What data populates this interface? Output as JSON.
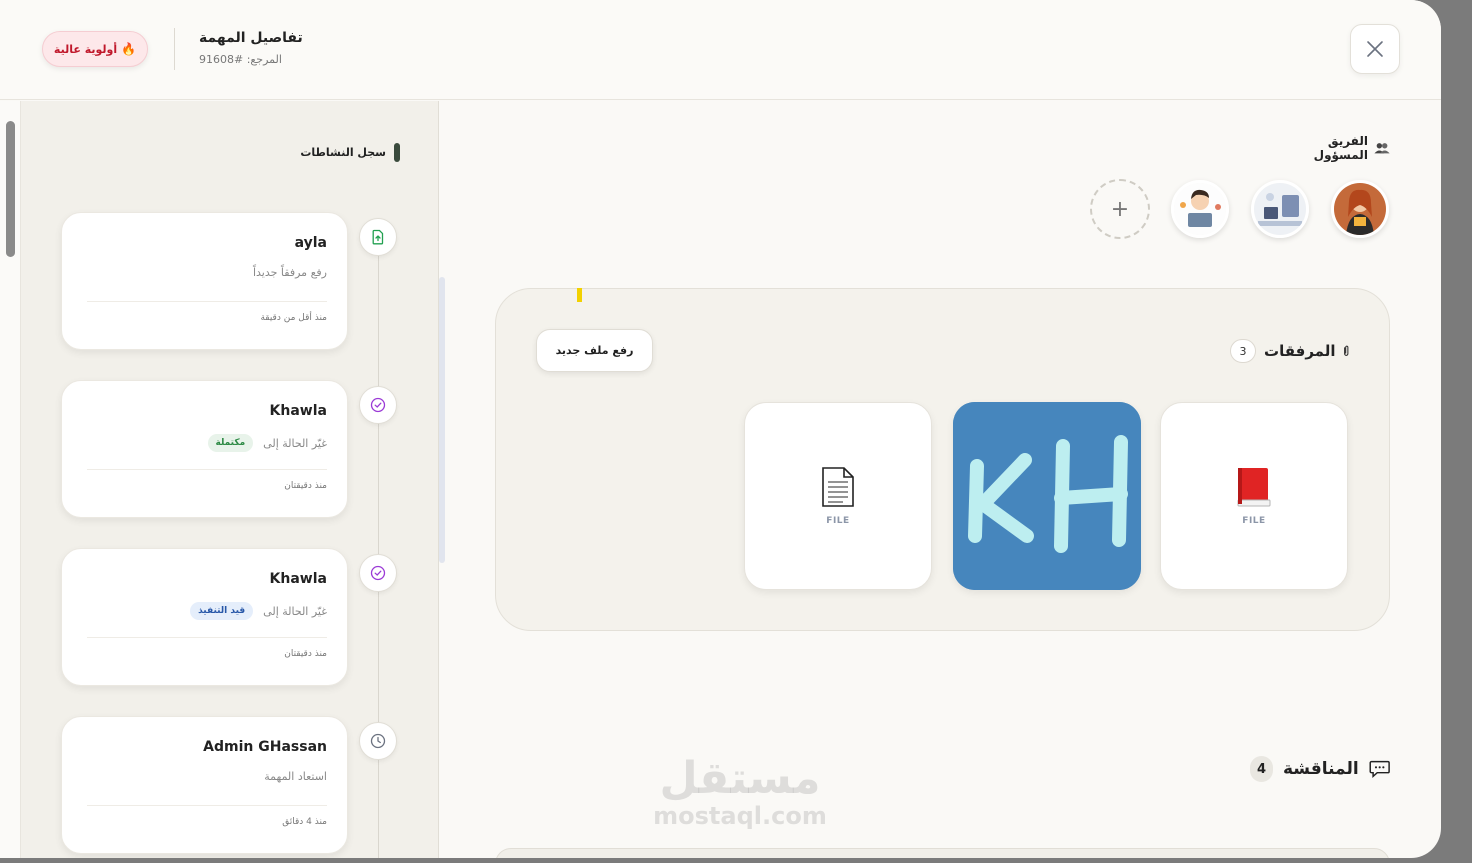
{
  "header": {
    "title": "تفاصيل المهمة",
    "reference": "المرجع: #91608",
    "priority_label": "أولوية عالية",
    "priority_icon": "fire-icon"
  },
  "activity": {
    "title": "سجل النشاطات",
    "items": [
      {
        "user": "ayla",
        "action": "رفع مرفقاً جديداً",
        "badge": "",
        "time": "منذ أقل من دقيقة",
        "icon": "file-upload-icon"
      },
      {
        "user": "Khawla",
        "action": "غيّر الحالة إلى",
        "badge": "مكتملة",
        "time": "منذ دقيقتان",
        "icon": "check-circle-icon"
      },
      {
        "user": "Khawla",
        "action": "غيّر الحالة إلى",
        "badge": "قيد التنفيذ",
        "time": "منذ دقيقتان",
        "icon": "check-circle-icon"
      },
      {
        "user": "Admin GHassan",
        "action": "استعاد المهمة",
        "badge": "",
        "time": "منذ 4 دقائق",
        "icon": "clock-icon"
      }
    ]
  },
  "team": {
    "label": "الفريق المسؤول",
    "add_label": "+"
  },
  "attachments": {
    "label": "المرفقات",
    "count": "3",
    "upload_label": "رفع ملف جديد",
    "files": [
      {
        "type_label": "FILE",
        "icon": "red-book-icon"
      },
      {
        "type_label": "",
        "icon": "kh-logo-image"
      },
      {
        "type_label": "FILE",
        "icon": "document-icon"
      }
    ]
  },
  "discussion": {
    "label": "المناقشة",
    "count": "4"
  },
  "watermark": {
    "arabic": "مستقل",
    "latin": "mostaql.com"
  },
  "colors": {
    "priority_text": "#c0182b",
    "badge_done": "#2d8a45",
    "badge_progress": "#2757a8",
    "image_tile": "#4686bd"
  }
}
